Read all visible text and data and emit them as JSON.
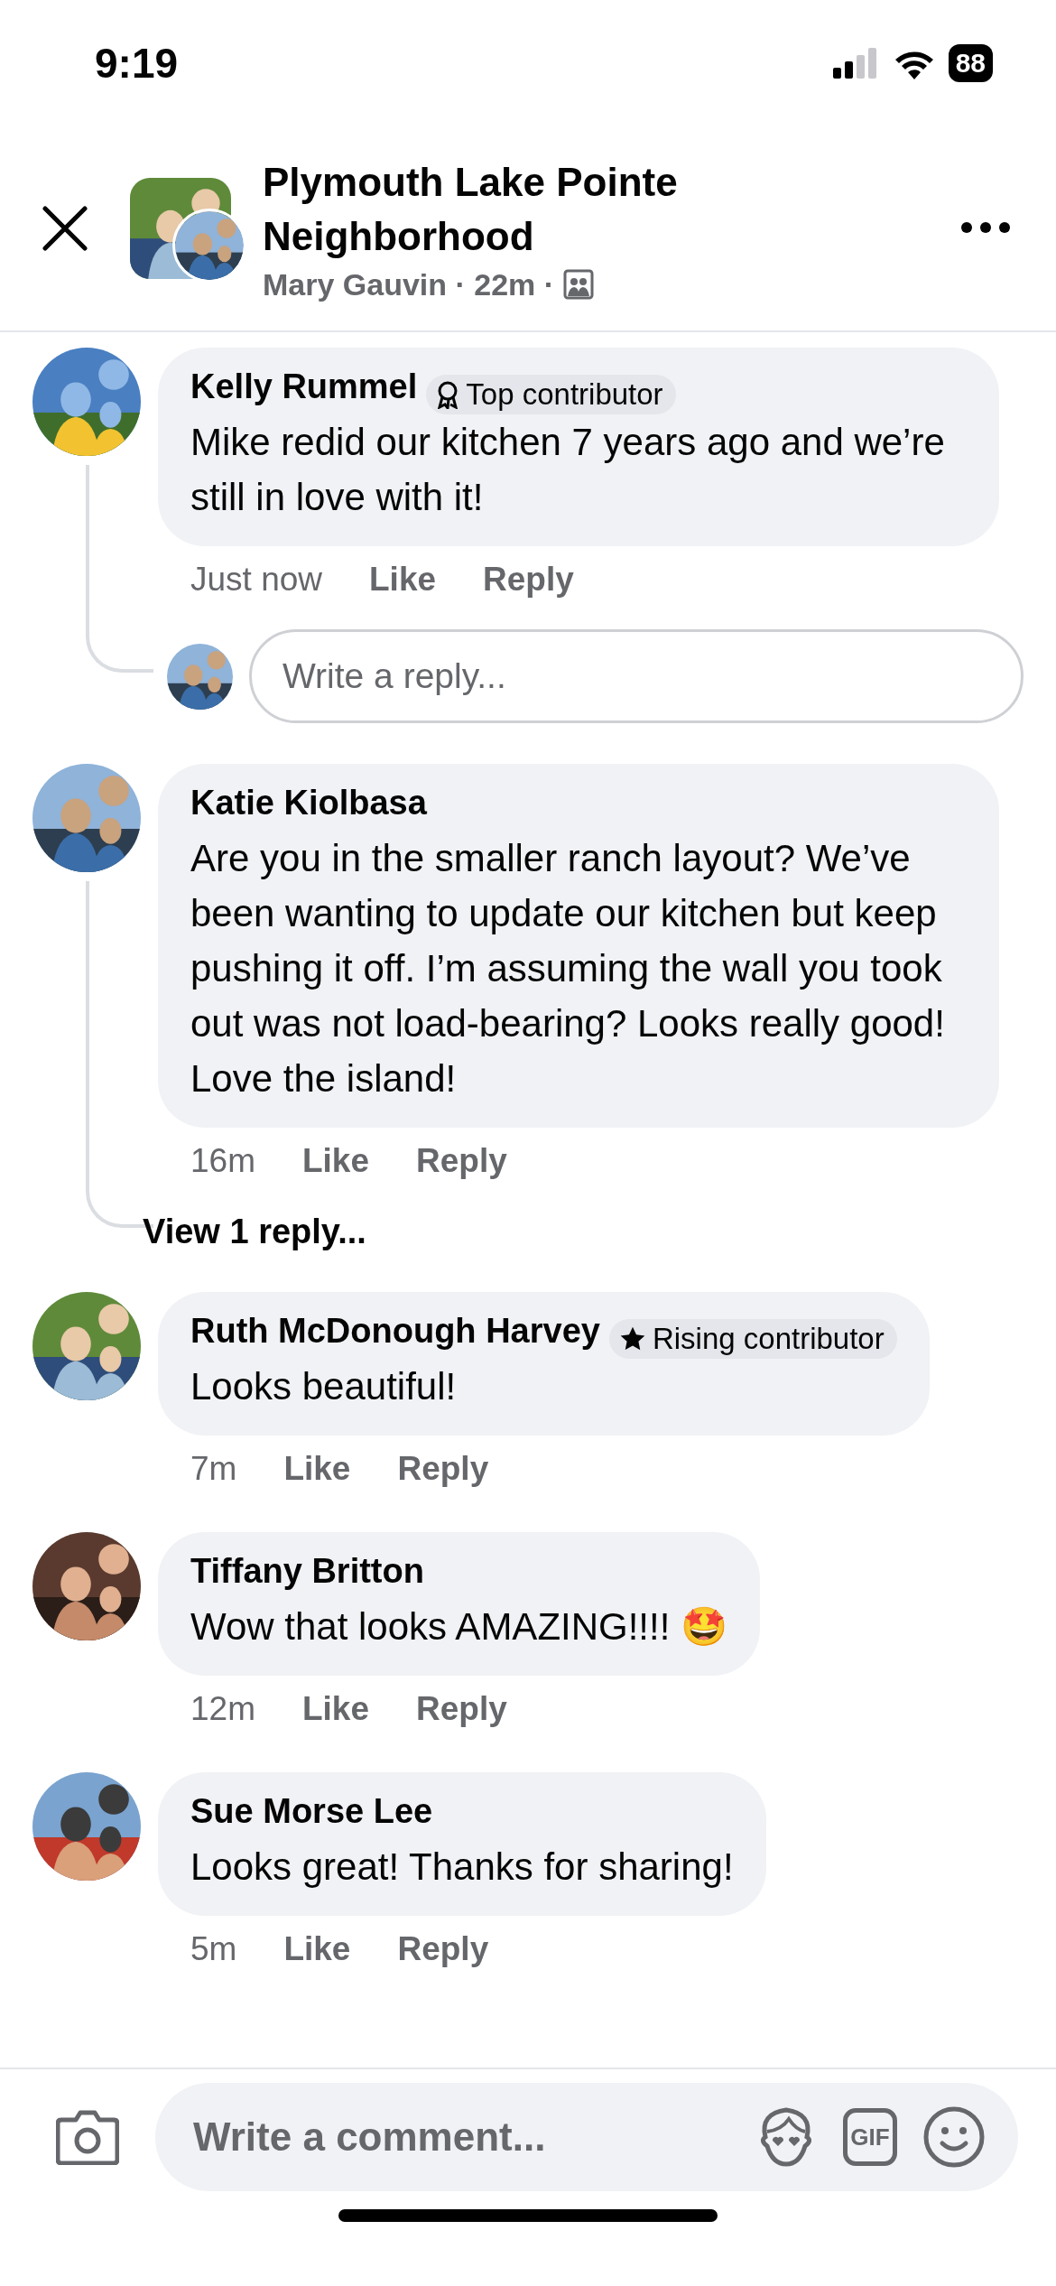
{
  "status_bar": {
    "time": "9:19",
    "battery": "88"
  },
  "header": {
    "title": "Plymouth Lake Pointe Neighborhood",
    "meta": "Mary Gauvin · 22m ·"
  },
  "comments": [
    {
      "author": "Kelly Rummel",
      "badge": {
        "kind": "top",
        "label": "Top contributor"
      },
      "text": "Mike redid our kitchen 7 years ago and we’re still in love with it!",
      "time": "Just now",
      "actions": [
        "Like",
        "Reply"
      ],
      "reply_field": {
        "placeholder": "Write a reply..."
      }
    },
    {
      "author": "Katie Kiolbasa",
      "text": "Are you in the smaller ranch layout?  We’ve been wanting to update our kitchen but keep pushing it off.  I’m assuming the wall you took out was not load-bearing?  Looks really good! Love the island!",
      "time": "16m",
      "actions": [
        "Like",
        "Reply"
      ],
      "view_replies": "View 1 reply..."
    },
    {
      "author": "Ruth McDonough Harvey",
      "badge": {
        "kind": "rising",
        "label": "Rising contributor"
      },
      "text": "Looks beautiful!",
      "time": "7m",
      "actions": [
        "Like",
        "Reply"
      ]
    },
    {
      "author": "Tiffany Britton",
      "text": "Wow that looks AMAZING!!!! 🤩",
      "time": "12m",
      "actions": [
        "Like",
        "Reply"
      ]
    },
    {
      "author": "Sue Morse Lee",
      "text": "Looks great!  Thanks for sharing!",
      "time": "5m",
      "actions": [
        "Like",
        "Reply"
      ]
    }
  ],
  "composer": {
    "placeholder": "Write a comment...",
    "gif_label": "GIF"
  }
}
